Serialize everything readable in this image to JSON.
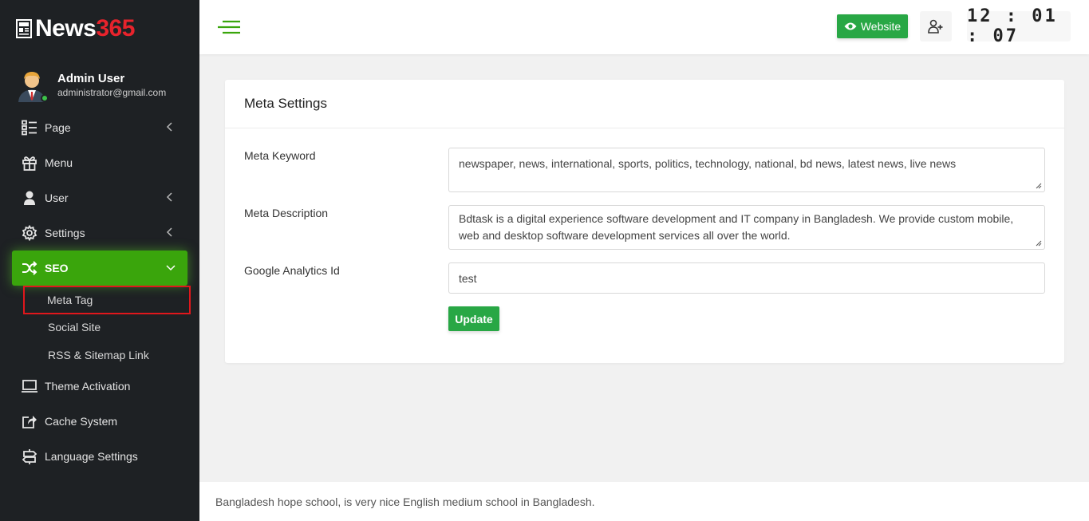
{
  "brand": {
    "name_part1": "News",
    "name_part2": "365",
    "accent_color": "#e8232c"
  },
  "user": {
    "name": "Admin User",
    "email": "administrator@gmail.com",
    "status": "online"
  },
  "sidebar": {
    "items": [
      {
        "label": "Page",
        "icon": "page-icon",
        "has_submenu": true
      },
      {
        "label": "Menu",
        "icon": "gift-icon",
        "has_submenu": false
      },
      {
        "label": "User",
        "icon": "user-icon",
        "has_submenu": true
      },
      {
        "label": "Settings",
        "icon": "gear-icon",
        "has_submenu": true
      },
      {
        "label": "SEO",
        "icon": "shuffle-icon",
        "has_submenu": true,
        "expanded": true,
        "children": [
          {
            "label": "Meta Tag",
            "highlighted": true
          },
          {
            "label": "Social Site"
          },
          {
            "label": "RSS & Sitemap Link"
          }
        ]
      },
      {
        "label": "Theme Activation",
        "icon": "laptop-icon",
        "has_submenu": false
      },
      {
        "label": "Cache System",
        "icon": "share-icon",
        "has_submenu": false
      },
      {
        "label": "Language Settings",
        "icon": "signpost-icon",
        "has_submenu": false
      }
    ],
    "active_color": "#3aa50c"
  },
  "header": {
    "website_label": "Website",
    "clock": "12:01:07",
    "button_color": "#28a745"
  },
  "meta_settings": {
    "title": "Meta Settings",
    "fields": {
      "keyword": {
        "label": "Meta Keyword",
        "value": "newspaper, news, international, sports, politics, technology, national, bd news, latest news, live news"
      },
      "description": {
        "label": "Meta Description",
        "value": "Bdtask is a digital experience software development and IT company in Bangladesh. We provide custom mobile, web and desktop software development services all over the world."
      },
      "analytics": {
        "label": "Google Analytics Id",
        "value": "test"
      }
    },
    "update_label": "Update"
  },
  "footer": {
    "text": "Bangladesh hope school, is very nice English medium school in Bangladesh."
  }
}
